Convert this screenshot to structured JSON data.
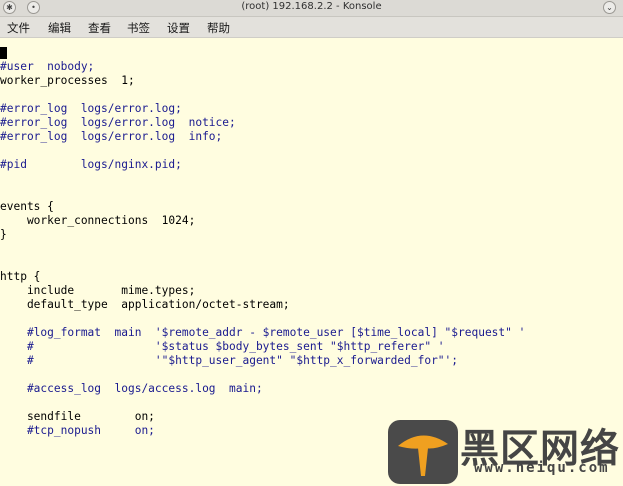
{
  "window": {
    "title": "(root) 192.168.2.2 - Konsole"
  },
  "menu": [
    "文件",
    "编辑",
    "查看",
    "书签",
    "设置",
    "帮助"
  ],
  "terminal": {
    "lines": [
      {
        "text": "",
        "type": "cursor"
      },
      {
        "text": "#user  nobody;",
        "type": "comment"
      },
      {
        "text": "worker_processes  1;",
        "type": "code"
      },
      {
        "text": "",
        "type": "blank"
      },
      {
        "text": "#error_log  logs/error.log;",
        "type": "comment"
      },
      {
        "text": "#error_log  logs/error.log  notice;",
        "type": "comment"
      },
      {
        "text": "#error_log  logs/error.log  info;",
        "type": "comment"
      },
      {
        "text": "",
        "type": "blank"
      },
      {
        "text": "#pid        logs/nginx.pid;",
        "type": "comment"
      },
      {
        "text": "",
        "type": "blank"
      },
      {
        "text": "",
        "type": "blank"
      },
      {
        "text": "events {",
        "type": "code"
      },
      {
        "text": "    worker_connections  1024;",
        "type": "code"
      },
      {
        "text": "}",
        "type": "code"
      },
      {
        "text": "",
        "type": "blank"
      },
      {
        "text": "",
        "type": "blank"
      },
      {
        "text": "http {",
        "type": "code"
      },
      {
        "text": "    include       mime.types;",
        "type": "code"
      },
      {
        "text": "    default_type  application/octet-stream;",
        "type": "code"
      },
      {
        "text": "",
        "type": "blank"
      },
      {
        "text": "    #log_format  main  '$remote_addr - $remote_user [$time_local] \"$request\" '",
        "type": "comment"
      },
      {
        "text": "    #                  '$status $body_bytes_sent \"$http_referer\" '",
        "type": "comment"
      },
      {
        "text": "    #                  '\"$http_user_agent\" \"$http_x_forwarded_for\"';",
        "type": "comment"
      },
      {
        "text": "",
        "type": "blank"
      },
      {
        "text": "    #access_log  logs/access.log  main;",
        "type": "comment"
      },
      {
        "text": "",
        "type": "blank"
      },
      {
        "text": "    sendfile        on;",
        "type": "code"
      },
      {
        "text": "    #tcp_nopush     on;",
        "type": "comment"
      }
    ],
    "colors": {
      "background": "#fffde0",
      "text": "#000000",
      "comment": "#1a1a8f"
    }
  },
  "watermark": {
    "title": "黑区网络",
    "url": "www.heiqu.com"
  }
}
